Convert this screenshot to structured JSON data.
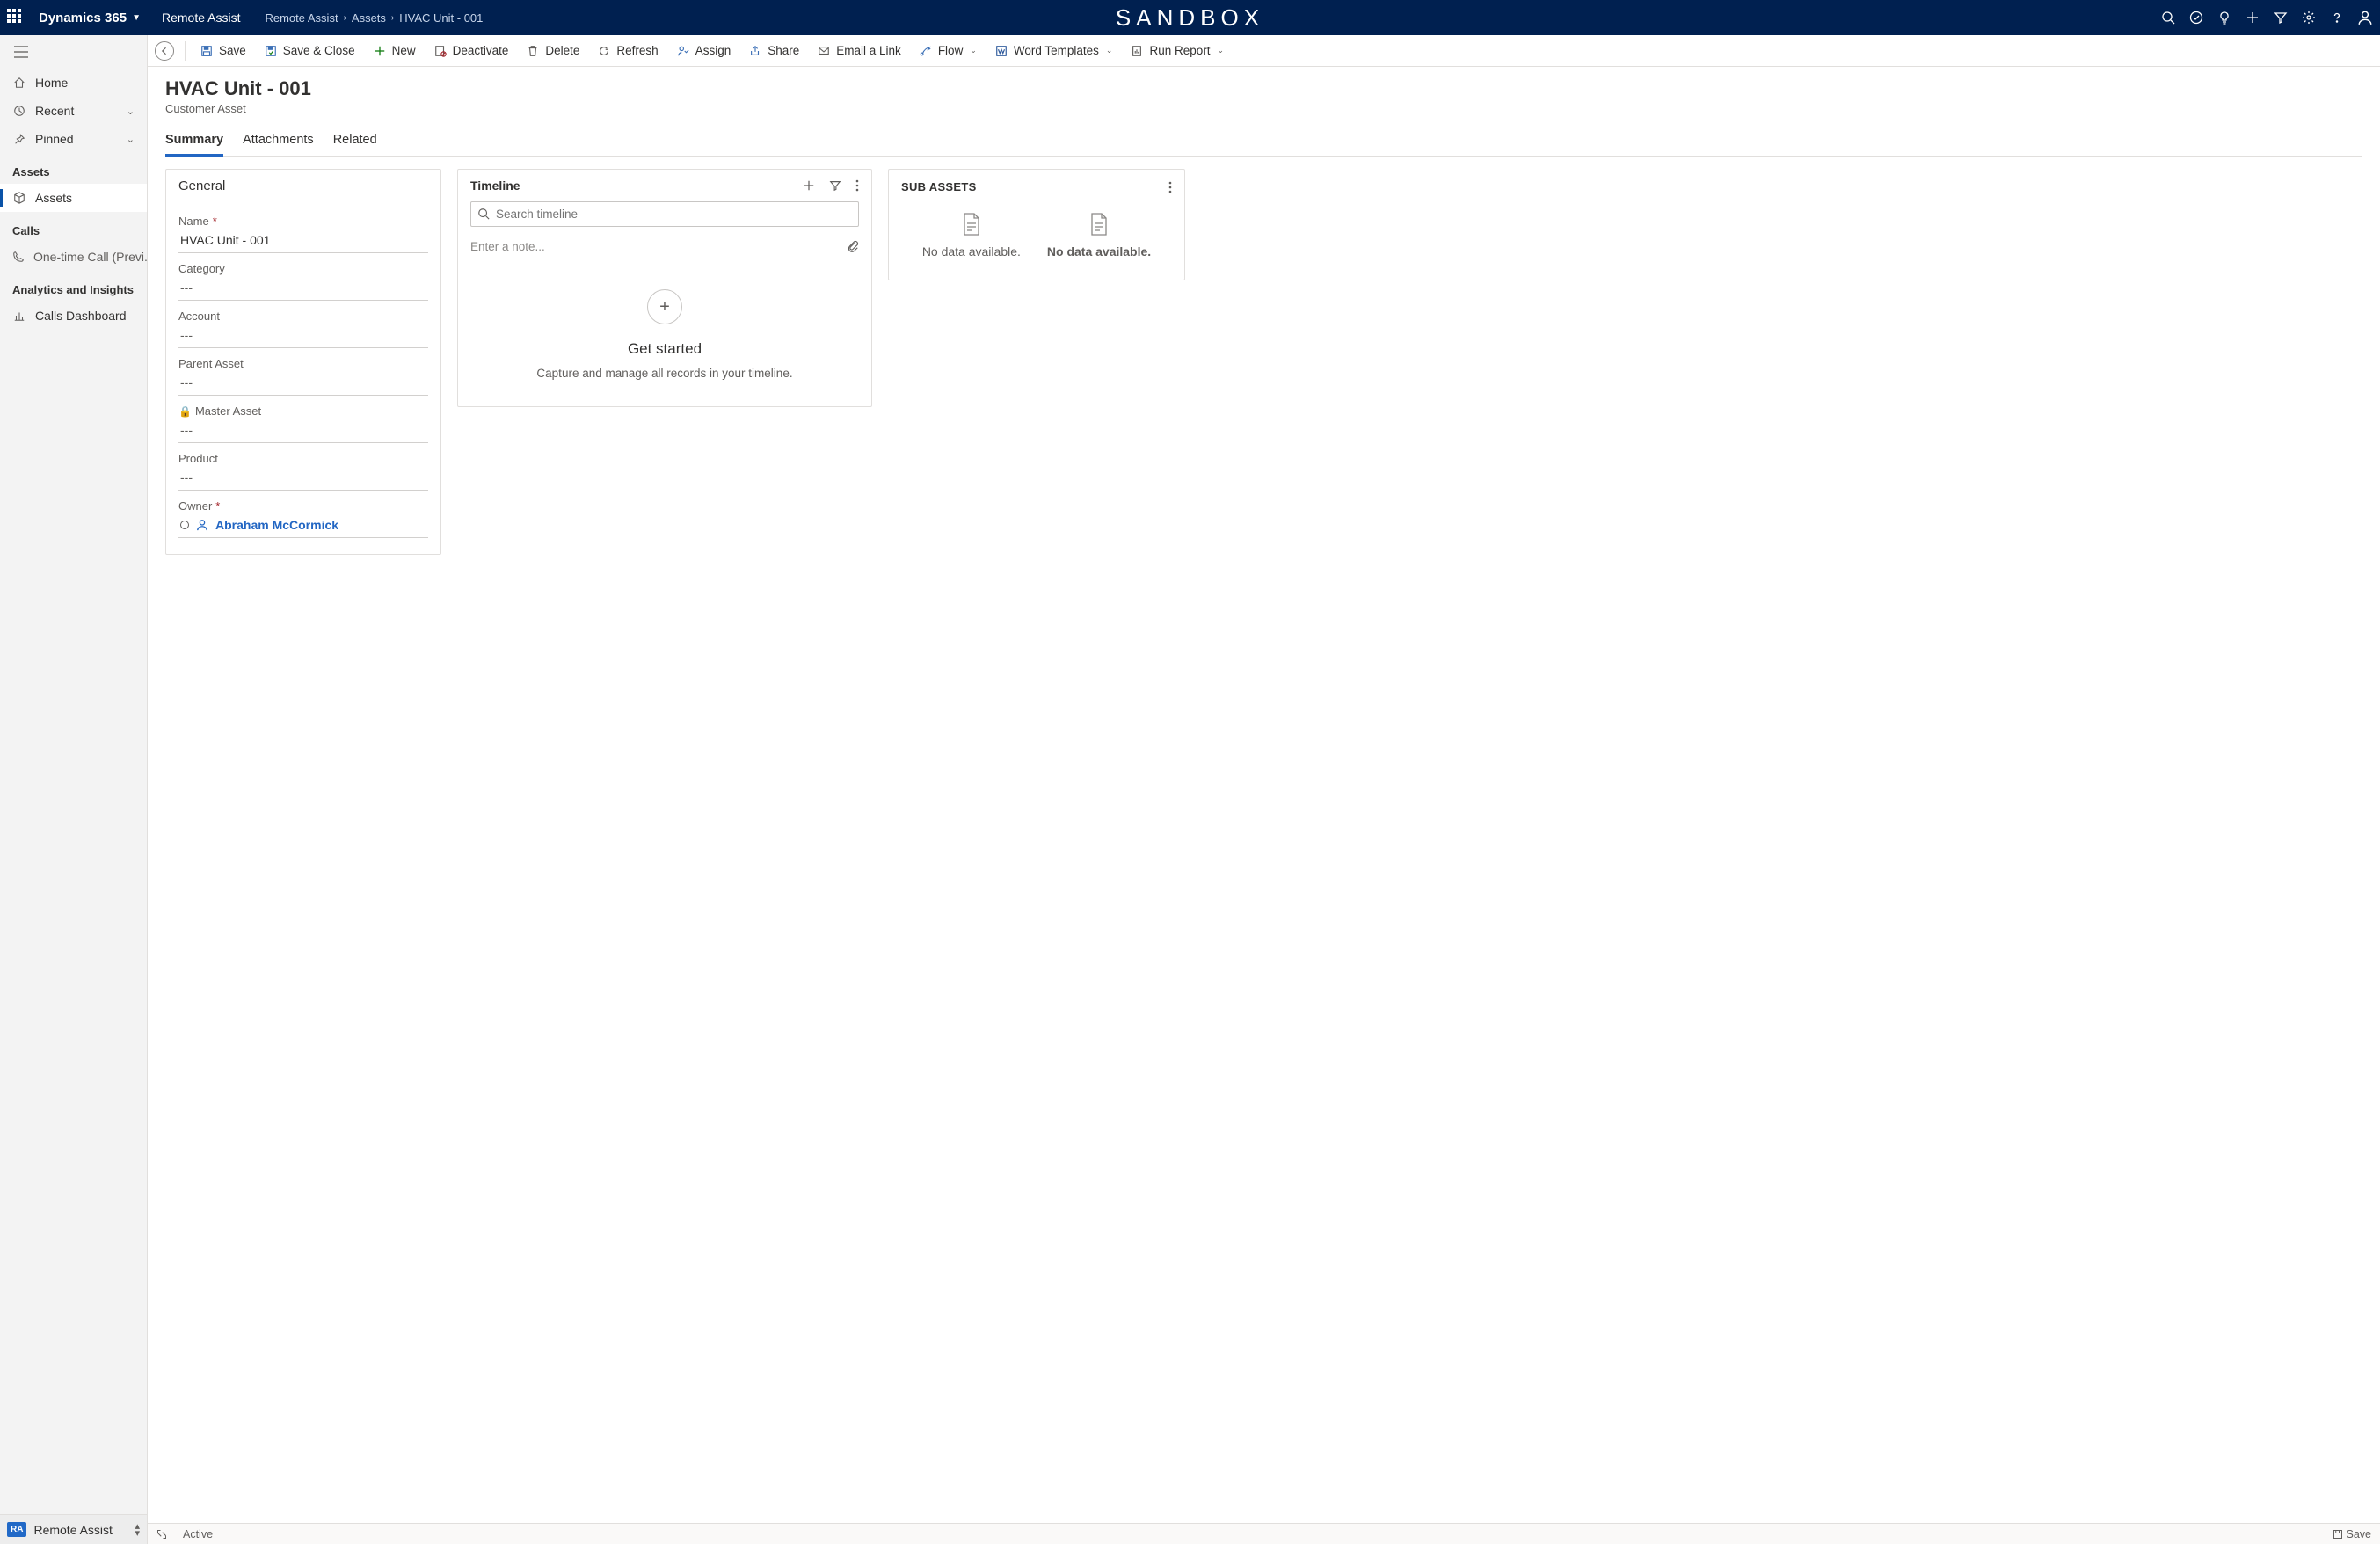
{
  "topbar": {
    "brand": "Dynamics 365",
    "app_name": "Remote Assist",
    "sandbox": "SANDBOX",
    "breadcrumbs": [
      "Remote Assist",
      "Assets",
      "HVAC Unit - 001"
    ]
  },
  "sidebar": {
    "home": "Home",
    "recent": "Recent",
    "pinned": "Pinned",
    "sections": {
      "assets": {
        "title": "Assets",
        "items": [
          "Assets"
        ]
      },
      "calls": {
        "title": "Calls",
        "items": [
          "One-time Call (Previ..."
        ]
      },
      "analytics": {
        "title": "Analytics and Insights",
        "items": [
          "Calls Dashboard"
        ]
      }
    },
    "footer": {
      "badge": "RA",
      "label": "Remote Assist"
    }
  },
  "commands": {
    "save": "Save",
    "save_close": "Save & Close",
    "new": "New",
    "deactivate": "Deactivate",
    "delete": "Delete",
    "refresh": "Refresh",
    "assign": "Assign",
    "share": "Share",
    "email": "Email a Link",
    "flow": "Flow",
    "word": "Word Templates",
    "report": "Run Report"
  },
  "record": {
    "title": "HVAC Unit - 001",
    "subtitle": "Customer Asset",
    "tabs": [
      "Summary",
      "Attachments",
      "Related"
    ]
  },
  "general": {
    "heading": "General",
    "fields": {
      "name": {
        "label": "Name",
        "value": "HVAC Unit - 001",
        "required": true
      },
      "category": {
        "label": "Category",
        "value": "---"
      },
      "account": {
        "label": "Account",
        "value": "---"
      },
      "parent": {
        "label": "Parent Asset",
        "value": "---"
      },
      "master": {
        "label": "Master Asset",
        "value": "---",
        "locked": true
      },
      "product": {
        "label": "Product",
        "value": "---"
      },
      "owner": {
        "label": "Owner",
        "value": "Abraham McCormick",
        "required": true
      }
    }
  },
  "timeline": {
    "heading": "Timeline",
    "search_placeholder": "Search timeline",
    "note_placeholder": "Enter a note...",
    "empty_title": "Get started",
    "empty_desc": "Capture and manage all records in your timeline."
  },
  "subassets": {
    "heading": "SUB ASSETS",
    "no_data": "No data available."
  },
  "status": {
    "active": "Active",
    "save": "Save"
  }
}
